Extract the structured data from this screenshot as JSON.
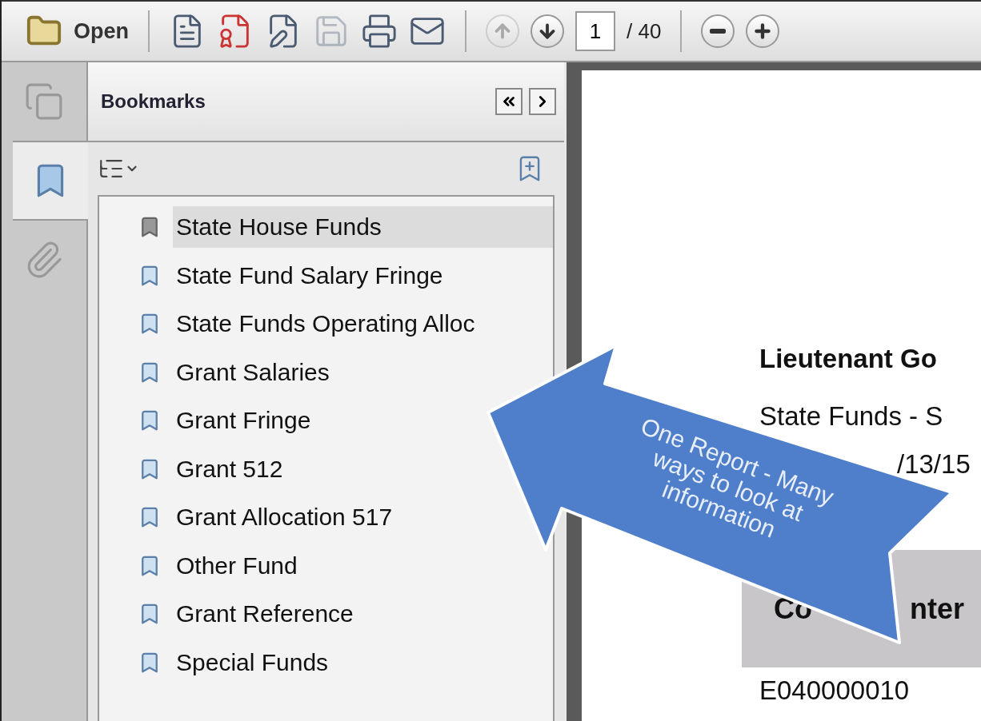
{
  "toolbar": {
    "open_label": "Open",
    "buttons": [
      {
        "kind": "create",
        "disabled": false
      },
      {
        "kind": "comment",
        "disabled": false
      },
      {
        "kind": "sign",
        "disabled": false
      },
      {
        "kind": "save",
        "disabled": true
      },
      {
        "kind": "print",
        "disabled": false
      },
      {
        "kind": "mail",
        "disabled": false
      }
    ],
    "nav": [
      {
        "kind": "up",
        "disabled": true
      },
      {
        "kind": "down",
        "disabled": false
      }
    ],
    "page": {
      "value": "1",
      "total": "/ 40"
    },
    "zoom": [
      {
        "kind": "minus",
        "disabled": false
      },
      {
        "kind": "plus",
        "disabled": false
      }
    ]
  },
  "side_tabs": [
    {
      "kind": "pages",
      "selected": false
    },
    {
      "kind": "bookmarks",
      "selected": true
    },
    {
      "kind": "attachments",
      "selected": false
    }
  ],
  "panel": {
    "title": "Bookmarks"
  },
  "bookmarks": [
    {
      "label": "State House Funds",
      "selected": true
    },
    {
      "label": "State Fund Salary Fringe",
      "selected": false
    },
    {
      "label": "State Funds Operating Alloc",
      "selected": false
    },
    {
      "label": "Grant Salaries",
      "selected": false
    },
    {
      "label": "Grant Fringe",
      "selected": false
    },
    {
      "label": "Grant 512",
      "selected": false
    },
    {
      "label": "Grant Allocation 517",
      "selected": false
    },
    {
      "label": "Other Fund",
      "selected": false
    },
    {
      "label": "Grant Reference",
      "selected": false
    },
    {
      "label": "Special Funds",
      "selected": false
    }
  ],
  "document": {
    "title": "Lieutenant Go",
    "subtitle": "State Funds - S",
    "date": "/13/15",
    "header_parts": [
      "Co",
      "nter"
    ],
    "cell": "E040000010"
  },
  "callout": {
    "lines": [
      "One Report - Many",
      "ways to look at",
      "information"
    ]
  }
}
